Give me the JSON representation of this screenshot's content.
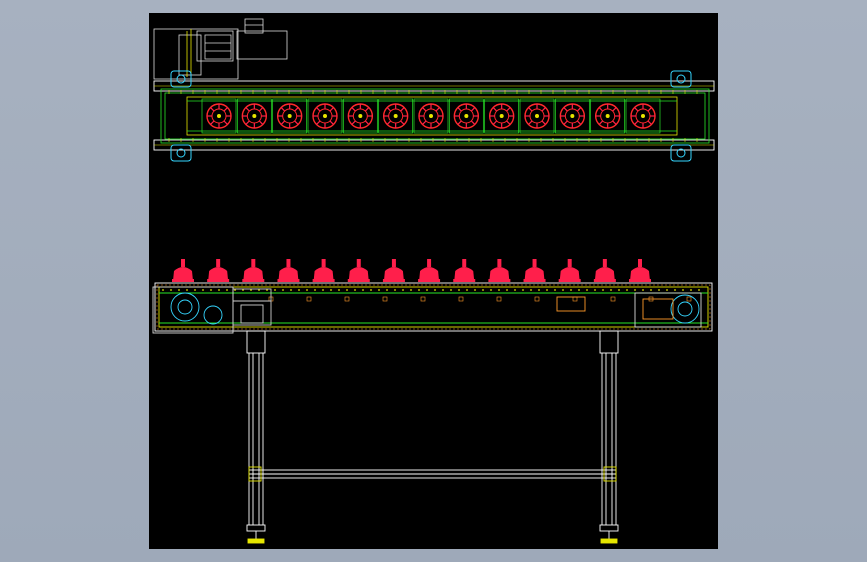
{
  "colors": {
    "frame": "#ffffff",
    "belt": "#e6e600",
    "track": "#27e627",
    "fixture": "#ff1f4b",
    "fixture_ring": "#ff2a2a",
    "bearing": "#35d6ff",
    "motor": "#d9d9d9",
    "frame_accent": "#ff9a2a",
    "background": "#000000"
  },
  "icons": {
    "top_view": "plan-view-icon",
    "front_view": "elevation-view-icon"
  },
  "conveyor": {
    "top_fixture_count": 13,
    "front_fixture_count": 14,
    "leg_count": 2
  }
}
